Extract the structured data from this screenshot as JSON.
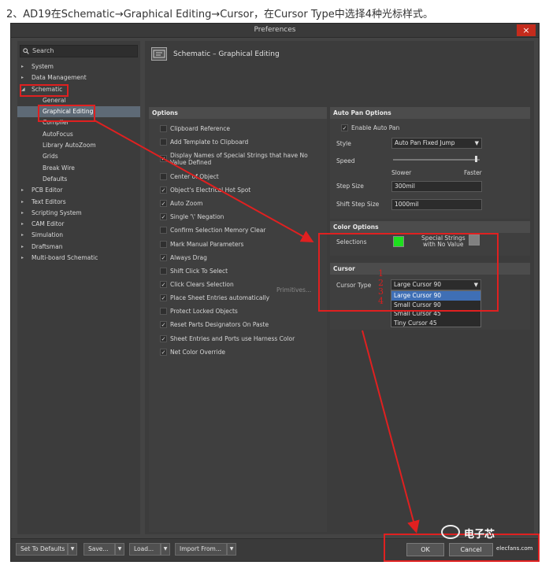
{
  "caption": "2、AD19在Schematic→Graphical Editing→Cursor，在Cursor Type中选择4种光标样式。",
  "window": {
    "title": "Preferences",
    "close": "×"
  },
  "search": {
    "placeholder": "Search"
  },
  "tree": [
    {
      "label": "System",
      "arrow": "▸"
    },
    {
      "label": "Data Management",
      "arrow": "▸"
    },
    {
      "label": "Schematic",
      "arrow": "◢"
    },
    {
      "label": "General"
    },
    {
      "label": "Graphical Editing"
    },
    {
      "label": "Compiler"
    },
    {
      "label": "AutoFocus"
    },
    {
      "label": "Library AutoZoom"
    },
    {
      "label": "Grids"
    },
    {
      "label": "Break Wire"
    },
    {
      "label": "Defaults"
    },
    {
      "label": "PCB Editor",
      "arrow": "▸"
    },
    {
      "label": "Text Editors",
      "arrow": "▸"
    },
    {
      "label": "Scripting System",
      "arrow": "▸"
    },
    {
      "label": "CAM Editor",
      "arrow": "▸"
    },
    {
      "label": "Simulation",
      "arrow": "▸"
    },
    {
      "label": "Draftsman",
      "arrow": "▸"
    },
    {
      "label": "Multi-board Schematic",
      "arrow": "▸"
    }
  ],
  "page_title": "Schematic – Graphical Editing",
  "options": {
    "title": "Options",
    "items": [
      {
        "label": "Clipboard Reference",
        "checked": false,
        "mark": ""
      },
      {
        "label": "Add Template to Clipboard",
        "checked": false,
        "mark": ""
      },
      {
        "label": "Display Names of Special Strings that have No",
        "label2": "Value Defined",
        "checked": true,
        "mark": "✓"
      },
      {
        "label": "Center of Object",
        "checked": false,
        "mark": ""
      },
      {
        "label": "Object's Electrical Hot Spot",
        "checked": true,
        "mark": "✓"
      },
      {
        "label": "Auto Zoom",
        "checked": true,
        "mark": "✓"
      },
      {
        "label": "Single '\\' Negation",
        "checked": true,
        "mark": "✓"
      },
      {
        "label": "Confirm Selection Memory Clear",
        "checked": false,
        "mark": ""
      },
      {
        "label": "Mark Manual Parameters",
        "checked": false,
        "mark": ""
      },
      {
        "label": "Always Drag",
        "checked": true,
        "mark": "✓"
      },
      {
        "label": "Shift Click To Select",
        "checked": false,
        "mark": ""
      },
      {
        "label": "Click Clears Selection",
        "checked": true,
        "mark": "✓"
      },
      {
        "label": "Place Sheet Entries automatically",
        "checked": true,
        "mark": "✓"
      },
      {
        "label": "Protect Locked Objects",
        "checked": false,
        "mark": ""
      },
      {
        "label": "Reset Parts Designators On Paste",
        "checked": true,
        "mark": "✓"
      },
      {
        "label": "Sheet Entries and Ports use Harness Color",
        "checked": true,
        "mark": "✓"
      },
      {
        "label": "Net Color Override",
        "checked": true,
        "mark": "✓"
      }
    ],
    "primitives_button": "Primitives..."
  },
  "autopan": {
    "title": "Auto Pan Options",
    "enable_label": "Enable Auto Pan",
    "enable_mark": "✓",
    "style_label": "Style",
    "style_value": "Auto Pan Fixed Jump",
    "speed_label": "Speed",
    "speed_level": 0.95,
    "slower": "Slower",
    "faster": "Faster",
    "step_size_label": "Step Size",
    "step_size_value": "300mil",
    "shift_step_label": "Shift Step Size",
    "shift_step_value": "1000mil"
  },
  "color_options": {
    "title": "Color Options",
    "selections_label": "Selections",
    "selections_color": "#1ee01e",
    "special_strings_label": "Special Strings",
    "special_strings_label2": "with No Value",
    "special_strings_color": "#808080"
  },
  "cursor": {
    "title": "Cursor",
    "type_label": "Cursor Type",
    "selected": "Large Cursor 90",
    "options": [
      "Large Cursor 90",
      "Small Cursor 90",
      "Small Cursor 45",
      "Tiny Cursor 45"
    ],
    "annotation_numbers": [
      "1",
      "2",
      "3",
      "4"
    ]
  },
  "footer": {
    "set_defaults": "Set To Defaults",
    "save": "Save...",
    "load": "Load...",
    "import": "Import From...",
    "ok": "OK",
    "cancel": "Cancel"
  },
  "watermark": {
    "title": "电子芯",
    "sub": "elecfans.com"
  },
  "colors": {
    "annotation_red": "#e02020",
    "selection_blue": "#3f6fb5"
  }
}
